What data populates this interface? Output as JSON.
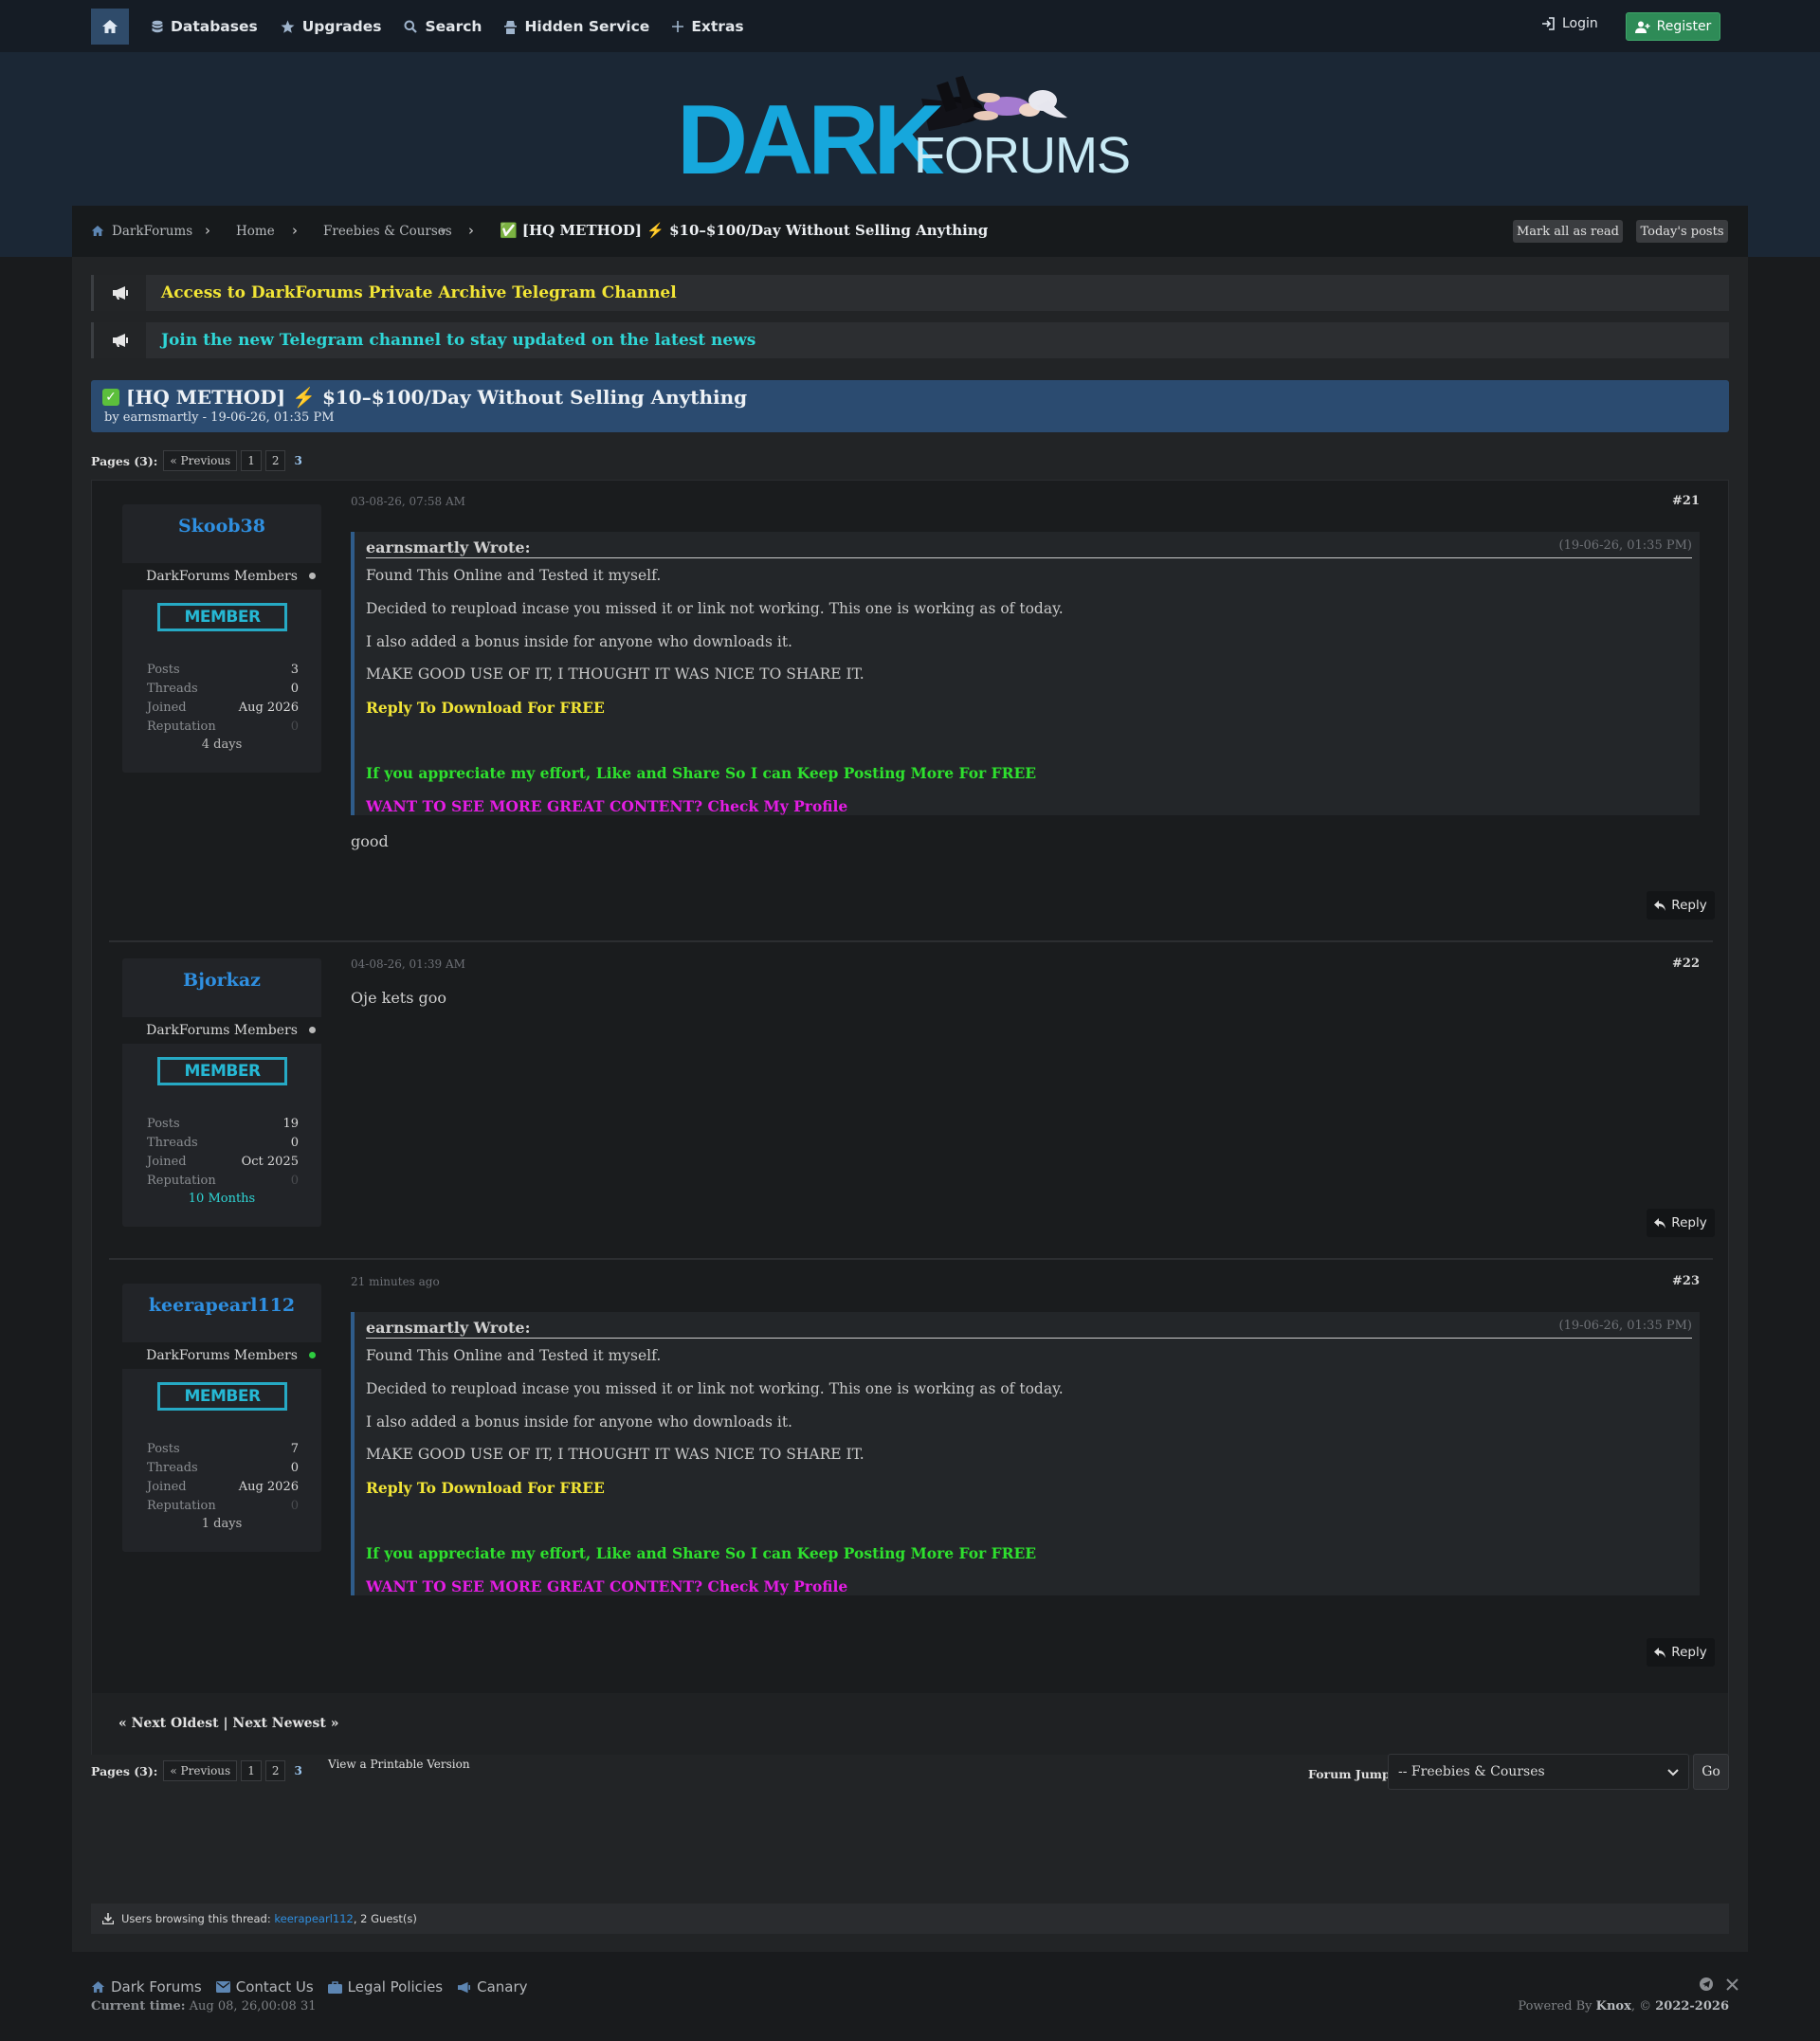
{
  "nav": {
    "items": [
      "Databases",
      "Upgrades",
      "Search",
      "Hidden Service",
      "Extras"
    ],
    "login": "Login",
    "register": "Register"
  },
  "breadcrumb": {
    "items": [
      "DarkForums",
      "Home",
      "Freebies & Courses"
    ],
    "current": "✅ [HQ METHOD] ⚡ $10–$100/Day Without Selling Anything",
    "mark_read": "Mark all as read",
    "todays_posts": "Today's posts"
  },
  "announcements": [
    {
      "text": "Access to DarkForums Private Archive Telegram Channel",
      "color": "#f2e536"
    },
    {
      "text": "Join the new Telegram channel to stay updated on the latest news",
      "color": "#2fd6d6"
    }
  ],
  "thread": {
    "title": "[HQ METHOD] ⚡ $10–$100/Day Without Selling Anything",
    "byline": "by earnsmartly - 19-06-26, 01:35 PM"
  },
  "pagination": {
    "label": "Pages (3):",
    "previous": "« Previous",
    "pages": [
      "1",
      "2"
    ],
    "current": "3"
  },
  "posts": [
    {
      "username": "Skoob38",
      "group": "DarkForums Members",
      "badge": "MEMBER",
      "stats": {
        "posts": "3",
        "threads": "0",
        "joined": "Aug 2026",
        "reputation": "0"
      },
      "tenure": "4 days",
      "date": "03-08-26, 07:58 AM",
      "number": "#21",
      "quote": {
        "author": "earnsmartly Wrote:",
        "date": "(19-06-26, 01:35 PM)",
        "lines": [
          "Found This Online and Tested it myself.",
          "Decided to reupload incase you missed it or link not working. This one is working as of today.",
          "I also added a bonus inside for anyone who downloads it.",
          "MAKE GOOD USE OF IT, I THOUGHT IT WAS NICE TO SHARE IT.",
          "Reply To Download For FREE",
          "If you appreciate my effort, Like and Share So I can Keep Posting More For FREE",
          "WANT TO SEE MORE GREAT CONTENT? Check My Profile"
        ]
      },
      "body": "good",
      "reply": "Reply"
    },
    {
      "username": "Bjorkaz",
      "group": "DarkForums Members",
      "badge": "MEMBER",
      "stats": {
        "posts": "19",
        "threads": "0",
        "joined": "Oct 2025",
        "reputation": "0"
      },
      "tenure": "10 Months",
      "date": "04-08-26, 01:39 AM",
      "number": "#22",
      "body": "Oje kets goo",
      "reply": "Reply"
    },
    {
      "username": "keerapearl112",
      "group": "DarkForums Members",
      "badge": "MEMBER",
      "stats": {
        "posts": "7",
        "threads": "0",
        "joined": "Aug 2026",
        "reputation": "0"
      },
      "tenure": "1 days",
      "date": "21 minutes ago",
      "number": "#23",
      "quote": {
        "author": "earnsmartly Wrote:",
        "date": "(19-06-26, 01:35 PM)",
        "lines": [
          "Found This Online and Tested it myself.",
          "Decided to reupload incase you missed it or link not working. This one is working as of today.",
          "I also added a bonus inside for anyone who downloads it.",
          "MAKE GOOD USE OF IT, I THOUGHT IT WAS NICE TO SHARE IT.",
          "Reply To Download For FREE",
          "If you appreciate my effort, Like and Share So I can Keep Posting More For FREE",
          "WANT TO SEE MORE GREAT CONTENT? Check My Profile"
        ]
      },
      "reply": "Reply"
    }
  ],
  "stat_labels": {
    "posts": "Posts",
    "threads": "Threads",
    "joined": "Joined",
    "reputation": "Reputation"
  },
  "next_links": "« Next Oldest | Next Newest »",
  "printable": "View a Printable Version",
  "forum_jump": {
    "label": "Forum Jump:",
    "selected": "-- Freebies & Courses",
    "go": "Go"
  },
  "browsing": {
    "prefix": "Users browsing this thread:",
    "user": "keerapearl112",
    "suffix": ", 2 Guest(s)"
  },
  "footer": {
    "links": [
      "Dark Forums",
      "Contact Us",
      "Legal Policies",
      "Canary"
    ],
    "current_time_label": "Current time:",
    "current_time": "Aug 08, 26,00:08 31",
    "powered_prefix": "Powered By",
    "powered_by": "Knox",
    "copyright_prefix": ", ©",
    "copyright": "2022-2026"
  },
  "logo": {
    "text1": "DARK",
    "text2": "FORUMS"
  },
  "colors": {
    "accent": "#2f8fe0",
    "register": "#2e8b57",
    "thread_head": "#2b4b70",
    "member_badge": "#26b8d4"
  }
}
